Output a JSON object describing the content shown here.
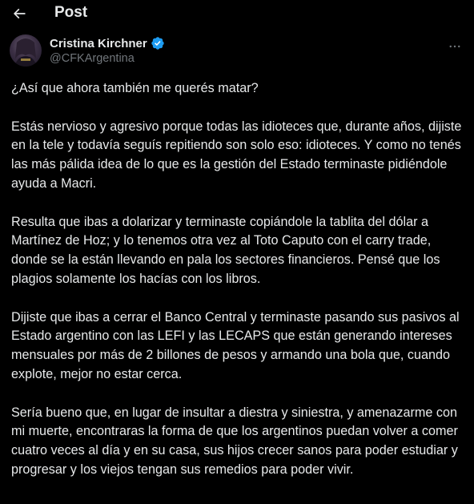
{
  "header": {
    "back_icon": "arrow-left-icon",
    "title": "Post"
  },
  "author": {
    "name": "Cristina Kirchner",
    "handle": "@CFKArgentina",
    "verified_icon": "verified-badge-icon",
    "verified_color": "#1d9bf0",
    "more_icon": "more-horizontal-icon"
  },
  "tweet": {
    "paragraphs": [
      "¿Así que ahora también me querés matar?",
      "Estás nervioso y agresivo porque todas las idioteces que, durante años, dijiste en la tele y todavía seguís repitiendo son solo eso: idioteces.  Y como no tenés las más pálida idea de lo que es la gestión del Estado terminaste pidiéndole ayuda a Macri.",
      "Resulta que ibas a dolarizar y terminaste copiándole la tablita del dólar a Martínez de Hoz; y lo tenemos otra vez al Toto Caputo con el carry trade, donde se la están llevando en pala los sectores financieros. Pensé que los plagios solamente los hacías con los libros.",
      "Dijiste que ibas a cerrar el Banco Central y terminaste pasando sus pasivos al Estado argentino con las LEFI y las LECAPS que están generando intereses mensuales por más de 2 billones de pesos y armando una bola que, cuando explote, mejor no estar cerca.",
      "Sería bueno que, en lugar de insultar a diestra y siniestra, y amenazarme con mi muerte, encontraras la forma de que los argentinos puedan volver a comer cuatro veces al día y en su casa, sus hijos crecer sanos para poder estudiar y progresar y los viejos tengan sus remedios para poder vivir."
    ]
  },
  "colors": {
    "background": "#000000",
    "text": "#e7e9ea",
    "secondary_text": "#71767b",
    "accent": "#1d9bf0"
  }
}
